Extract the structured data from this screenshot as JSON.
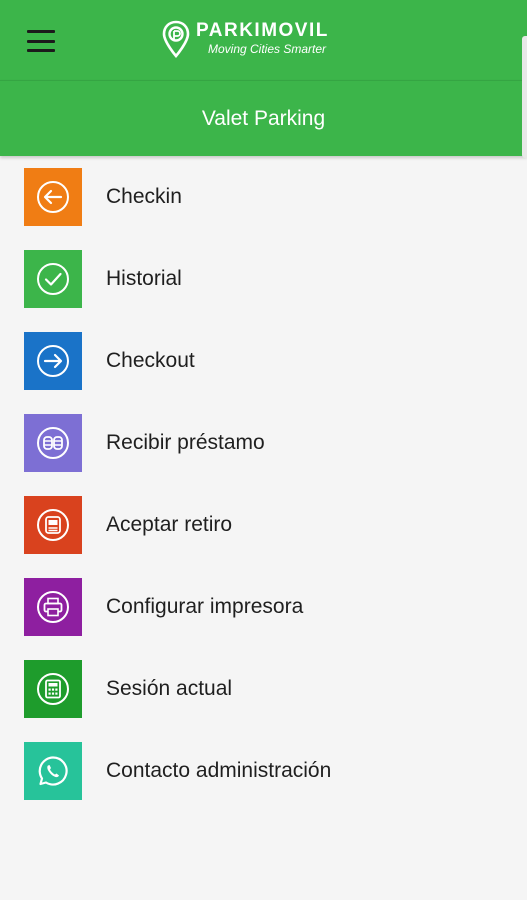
{
  "header": {
    "menu_icon": "hamburger-menu-icon",
    "brand_name": "PARKIMOVIL",
    "brand_tagline": "Moving Cities Smarter",
    "brand_color": "#3cb54a"
  },
  "subheader": {
    "title": "Valet Parking"
  },
  "menu": {
    "items": [
      {
        "label": "Checkin",
        "icon": "arrow-left-circle-icon",
        "color": "#f07d14"
      },
      {
        "label": "Historial",
        "icon": "check-circle-icon",
        "color": "#3cb54a"
      },
      {
        "label": "Checkout",
        "icon": "arrow-right-circle-icon",
        "color": "#1a73c8"
      },
      {
        "label": "Recibir préstamo",
        "icon": "coins-icon",
        "color": "#7d6fd4"
      },
      {
        "label": "Aceptar retiro",
        "icon": "cash-register-icon",
        "color": "#d9421e"
      },
      {
        "label": "Configurar impresora",
        "icon": "printer-icon",
        "color": "#8e1fa0"
      },
      {
        "label": "Sesión actual",
        "icon": "calculator-icon",
        "color": "#1e9c2c"
      },
      {
        "label": "Contacto administración",
        "icon": "whatsapp-icon",
        "color": "#27c39a"
      }
    ]
  }
}
